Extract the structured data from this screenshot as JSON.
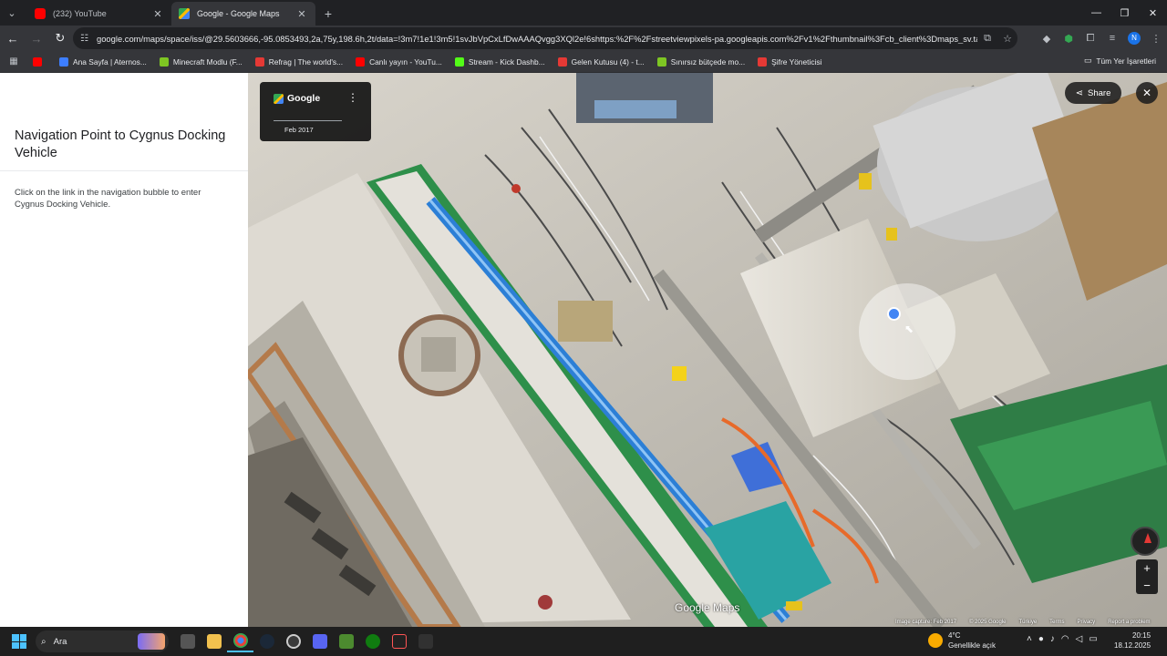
{
  "browser": {
    "tabs": [
      {
        "title": "(232) YouTube",
        "icon": "youtube-icon"
      },
      {
        "title": "Google - Google Maps",
        "icon": "google-maps-icon"
      }
    ],
    "url": "google.com/maps/space/iss/@29.5603666,-95.0853493,2a,75y,198.6h,2t/data=!3m7!1e1!3m5!1svJbVpCxLfDwAAAQvgg3XQl2e!6shttps:%2F%2Fstreetviewpixels-pa.googleapis.com%2Fv1%2Fthumbnail%3Fcb_client%3Dmaps_sv.tac...",
    "profile_initial": "N",
    "bookmarks": [
      {
        "label": "",
        "color": "#ff0000"
      },
      {
        "label": "Ana Sayfa | Aternos...",
        "color": "#3d7eff"
      },
      {
        "label": "Minecraft Modlu (F...",
        "color": "#7ec623"
      },
      {
        "label": "Refrag | The world's...",
        "color": "#e53935"
      },
      {
        "label": "Canlı yayın - YouTu...",
        "color": "#ff0000"
      },
      {
        "label": "Stream - Kick Dashb...",
        "color": "#53fc18"
      },
      {
        "label": "Gelen Kutusu (4) - t...",
        "color": "#e53935"
      },
      {
        "label": "Sınırsız bütçede mo...",
        "color": "#7ec623"
      },
      {
        "label": "Şifre Yöneticisi",
        "color": "#e53935"
      }
    ],
    "all_bookmarks": "Tüm Yer İşaretleri"
  },
  "sidepanel": {
    "title": "Navigation Point to Cygnus Docking Vehicle",
    "description": "Click on the link in the navigation bubble to enter Cygnus Docking Vehicle."
  },
  "viewer": {
    "brand": "Google",
    "date": "Feb 2017",
    "share_label": "Share",
    "watermark": "Google Maps",
    "credits": [
      "Image capture: Feb 2017",
      "© 2025 Google",
      "Türkiye",
      "Terms",
      "Privacy",
      "Report a problem"
    ]
  },
  "taskbar": {
    "search_placeholder": "Ara",
    "weather_temp": "4°C",
    "weather_desc": "Genellikle açık",
    "time": "20:15",
    "date": "18.12.2025"
  },
  "colors": {
    "accent_blue": "#4285f4",
    "sidepanel_bg": "#ffffff",
    "chrome_dark": "#202124"
  }
}
